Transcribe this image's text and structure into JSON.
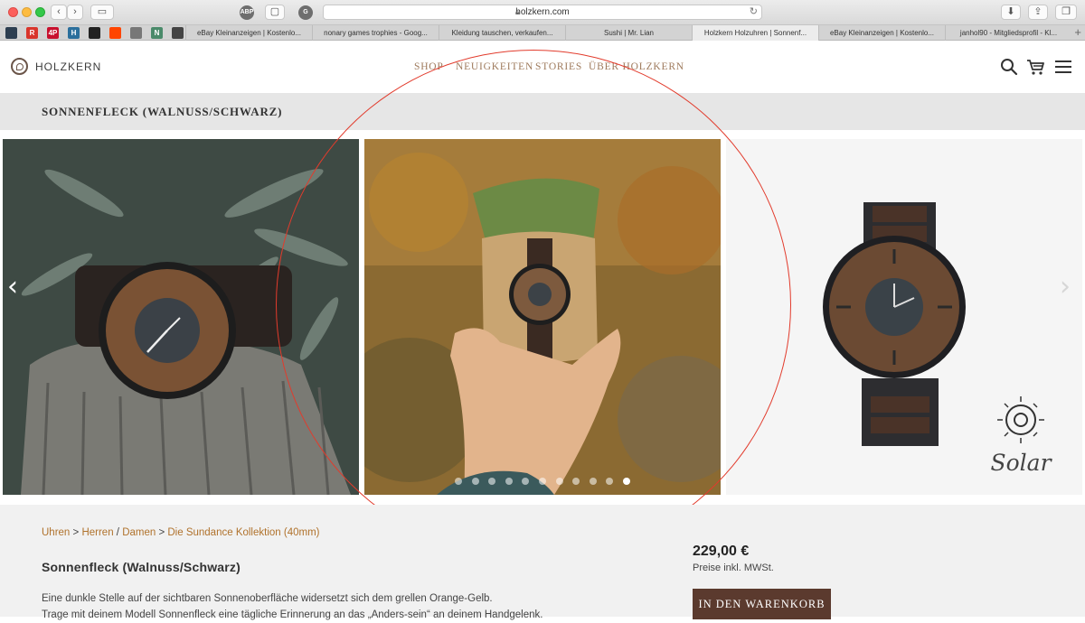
{
  "browser": {
    "url": "holzkern.com",
    "extensions": [
      "ABP",
      "G"
    ],
    "tabs": [
      {
        "label": "eBay Kleinanzeigen | Kostenlo...",
        "active": false
      },
      {
        "label": "nonary games trophies - Goog...",
        "active": false
      },
      {
        "label": "Kleidung tauschen, verkaufen...",
        "active": false
      },
      {
        "label": "Sushi | Mr. Lian",
        "active": false
      },
      {
        "label": "Holzkern Holzuhren | Sonnenf...",
        "active": true
      },
      {
        "label": "eBay Kleinanzeigen | Kostenlo...",
        "active": false
      },
      {
        "label": "janhol90 - Mitgliedsprofil - Kl...",
        "active": false
      }
    ],
    "favicons": [
      {
        "label": "",
        "color": "#2d3e50",
        "icon": "cloud-icon"
      },
      {
        "label": "R",
        "color": "#d9352b",
        "icon": "rocket-icon"
      },
      {
        "label": "4P",
        "color": "#c8102e",
        "icon": "4p-icon"
      },
      {
        "label": "H",
        "color": "#2b6f9c",
        "icon": "h-icon"
      },
      {
        "label": "",
        "color": "#222222",
        "icon": "github-icon"
      },
      {
        "label": "",
        "color": "#ff4500",
        "icon": "reddit-icon"
      },
      {
        "label": "",
        "color": "#777777",
        "icon": "trello-icon"
      },
      {
        "label": "N",
        "color": "#4a8a6a",
        "icon": "n-icon"
      },
      {
        "label": "",
        "color": "#444444",
        "icon": "instagram-icon"
      }
    ]
  },
  "header": {
    "brand": "HOLZKERN",
    "nav": [
      "SHOP",
      "NEUIGKEITEN",
      "STORIES",
      "ÜBER HOLZKERN"
    ]
  },
  "page": {
    "title": "SONNENFLECK (WALNUSS/SCHWARZ)"
  },
  "gallery": {
    "dot_count": 11,
    "active_dot": 11,
    "solar_label": "Solar"
  },
  "product": {
    "breadcrumb": [
      {
        "label": "Uhren",
        "sep": " > "
      },
      {
        "label": "Herren",
        "sep": " / "
      },
      {
        "label": "Damen",
        "sep": " > "
      },
      {
        "label": "Die Sundance Kollektion (40mm)",
        "sep": ""
      }
    ],
    "name": "Sonnenfleck (Walnuss/Schwarz)",
    "description_1": "Eine dunkle Stelle auf der sichtbaren Sonnenoberfläche widersetzt sich dem grellen Orange-Gelb.",
    "description_2": "Trage mit deinem Modell Sonnenfleck eine tägliche Erinnerung an das „Anders-sein“ an deinem Handgelenk.",
    "price": "229,00 €",
    "vat": "Preise inkl. MWSt.",
    "cart_button": "IN DEN WARENKORB"
  },
  "colors": {
    "accent": "#b0722c",
    "nav": "#9e7a5c",
    "button": "#5b3a2e",
    "annotation": "#e23b2c"
  }
}
